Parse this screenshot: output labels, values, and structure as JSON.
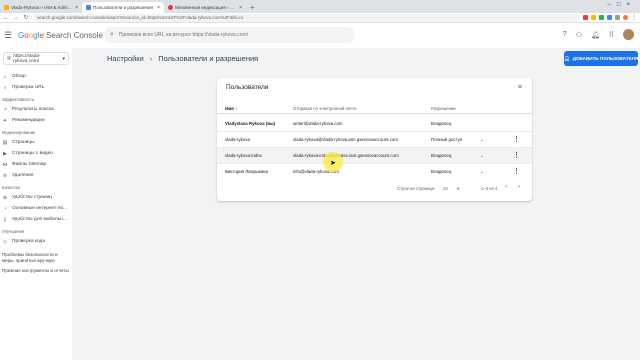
{
  "browser": {
    "tabs": [
      {
        "label": "Vlada-Rykova » IAM & Admin »",
        "active": false
      },
      {
        "label": "Пользователи и разрешения",
        "active": true
      },
      {
        "label": "Мгновенная индексация › Блог",
        "active": false
      }
    ],
    "new_tab": "+",
    "url": "search.google.com/search-console/users?resource_id=https%3A%2F%2Fvlada-rykova.com%2F&hl=ru"
  },
  "app": {
    "logo": {
      "g": "G",
      "o1": "o",
      "o2": "o",
      "g2": "g",
      "l": "l",
      "e": "e",
      "rest": " Search Console"
    },
    "search_placeholder": "Проверка всех URL на ресурсе https://vlada-rykova.com/"
  },
  "sidebar": {
    "property": "https://vlada-rykova.com/",
    "items": [
      {
        "label": "Обзор",
        "icon": "home-icon"
      },
      {
        "label": "Проверка URL",
        "icon": "search-icon"
      }
    ],
    "sections": [
      {
        "title": "Эффективность",
        "items": [
          {
            "label": "Результаты поиска",
            "icon": "chart-icon"
          },
          {
            "label": "Рекомендации",
            "icon": "star-icon"
          }
        ]
      },
      {
        "title": "Индексирование",
        "items": [
          {
            "label": "Страницы",
            "icon": "pages-icon"
          },
          {
            "label": "Страницы с видео",
            "icon": "video-icon"
          },
          {
            "label": "Файлы Sitemap",
            "icon": "sitemap-icon"
          },
          {
            "label": "Удаления",
            "icon": "remove-icon"
          }
        ]
      },
      {
        "title": "Качество",
        "items": [
          {
            "label": "Удобство страниц",
            "icon": "page-exp-icon"
          },
          {
            "label": "Основные интернет-по...",
            "icon": "vitals-icon"
          },
          {
            "label": "Удобство для мобильн...",
            "icon": "mobile-icon"
          }
        ]
      },
      {
        "title": "Улучшения",
        "items": [
          {
            "label": "Проверка кода",
            "icon": "code-icon"
          }
        ]
      }
    ],
    "links": [
      "Проблемы безопасности и меры, принятые вручную",
      "Прежние инструменты и отчеты"
    ]
  },
  "main": {
    "breadcrumb": {
      "parent": "Настройки",
      "current": "Пользователи и разрешения"
    },
    "add_button": "ДОБАВИТЬ ПОЛЬЗОВАТЕЛЯ",
    "card": {
      "title": "Пользователи",
      "columns": {
        "name": "Имя",
        "sort": "↑",
        "email": "Отправка по электронной почте",
        "role": "Разрешение"
      },
      "rows": [
        {
          "name": "Vladyslava Rykova (вы)",
          "email": "writer@vlada-rykova.com",
          "role": "Владелец"
        },
        {
          "name": "vlada-rykova",
          "email": "vlada-rykova@vlada-rykova.iam.gserviceaccount.com",
          "role": "Полный доступ"
        },
        {
          "name": "vlada-rykova-index",
          "email": "vlada-rykova-index@vlindex.iam.gserviceaccount.com",
          "role": "Владелец"
        },
        {
          "name": "Виктория Лапушкина",
          "email": "info@vlada-rykova.com",
          "role": "Владелец"
        }
      ],
      "footer": {
        "rows_label": "Строк на странице:",
        "rows_value": "10",
        "range": "1–4 из 4"
      }
    }
  },
  "colors": {
    "accent": "#1a73e8",
    "cursor_highlight": "#ffeb3b"
  }
}
